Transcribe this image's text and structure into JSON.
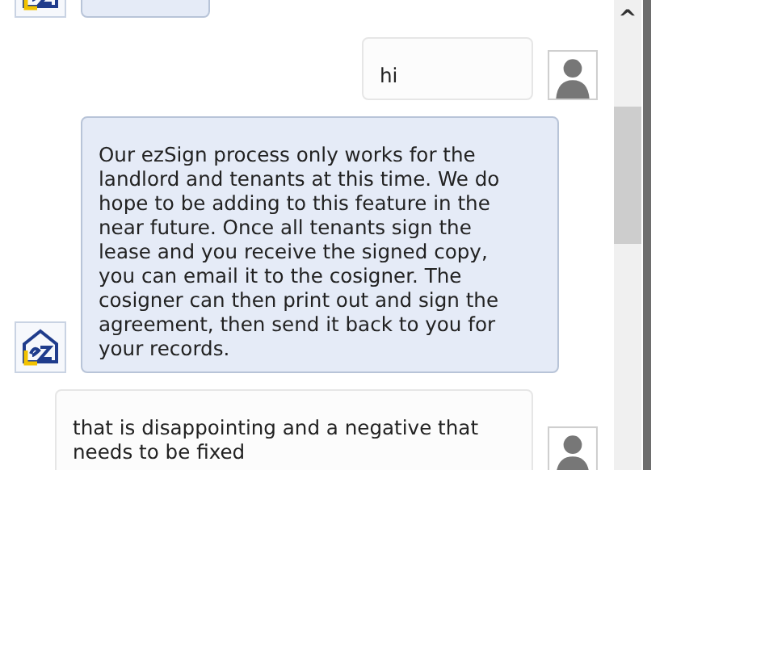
{
  "messages": [
    {
      "kind": "agent"
    },
    {
      "kind": "user",
      "text": "hi"
    },
    {
      "kind": "agent",
      "text": "Our ezSign process only works for the landlord and tenants at this time. We do hope to be adding to this feature in the near future. Once all tenants sign the lease and you receive the signed copy, you can email it to the cosigner. The cosigner can then print out and sign the agreement, then send it back to you for your records."
    },
    {
      "kind": "user",
      "text": "that is disappointing and a negative that needs to be fixed"
    }
  ],
  "scrollbar": {
    "up_arrow": "^"
  }
}
